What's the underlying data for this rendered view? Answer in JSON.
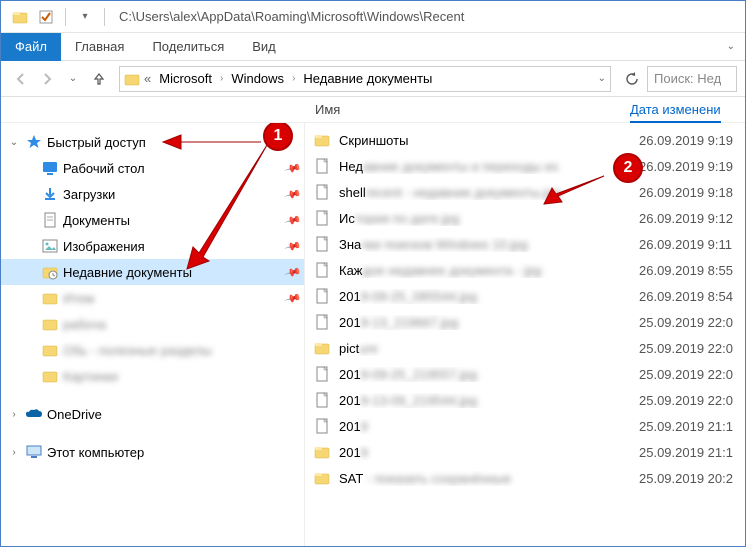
{
  "titlebar": {
    "address": "C:\\Users\\alex\\AppData\\Roaming\\Microsoft\\Windows\\Recent"
  },
  "ribbon": {
    "file": "Файл",
    "home": "Главная",
    "share": "Поделиться",
    "view": "Вид"
  },
  "nav": {
    "breadcrumb": [
      "Microsoft",
      "Windows",
      "Недавние документы"
    ],
    "search_placeholder": "Поиск: Нед"
  },
  "columns": {
    "name": "Имя",
    "date": "Дата изменени"
  },
  "tree": {
    "quick": "Быстрый доступ",
    "desktop": "Рабочий стол",
    "downloads": "Загрузки",
    "documents": "Документы",
    "pictures": "Изображения",
    "recent": "Недавние документы",
    "blur1": "Итем",
    "blur2": "рабоча",
    "blur3": "Обь - полезные разделы",
    "blur4": "Картинки",
    "onedrive": "OneDrive",
    "thispc": "Этот компьютер"
  },
  "files": [
    {
      "name": "Скриншоты",
      "type": "folder",
      "date": "26.09.2019 9:19"
    },
    {
      "name_prefix": "Нед",
      "name_blur": "авние документы и переходы из",
      "type": "file",
      "date": "26.09.2019 9:19"
    },
    {
      "name_prefix": "shell",
      "name_blur": "recent - недавние документы.jpg",
      "type": "file",
      "date": "26.09.2019 9:18"
    },
    {
      "name_prefix": "Ис",
      "name_blur": "тория по дате.jpg",
      "type": "file",
      "date": "26.09.2019 9:12"
    },
    {
      "name_prefix": "Зна",
      "name_blur": "чки поисков Windows 10.jpg",
      "type": "file",
      "date": "26.09.2019 9:11"
    },
    {
      "name_prefix": "Каж",
      "name_blur": "дое недавнее документа - jpg",
      "type": "file",
      "date": "26.09.2019 8:55"
    },
    {
      "name_prefix": "201",
      "name_blur": "9-09-25_085544.jpg",
      "type": "file",
      "date": "26.09.2019 8:54"
    },
    {
      "name_prefix": "201",
      "name_blur": "9-13_219667.jpg",
      "type": "file",
      "date": "25.09.2019 22:0"
    },
    {
      "name_prefix": "pict",
      "name_blur": "ure",
      "type": "folder",
      "date": "25.09.2019 22:0"
    },
    {
      "name_prefix": "201",
      "name_blur": "9-09-25_219557.jpg",
      "type": "file",
      "date": "25.09.2019 22:0"
    },
    {
      "name_prefix": "201",
      "name_blur": "9-13-09_219544.jpg",
      "type": "file",
      "date": "25.09.2019 22:0"
    },
    {
      "name_prefix": "201",
      "name_blur": "9",
      "type": "file",
      "date": "25.09.2019 21:1"
    },
    {
      "name_prefix": "201",
      "name_blur": "9",
      "type": "folder",
      "date": "25.09.2019 21:1"
    },
    {
      "name_prefix": "SAT",
      "name_blur": " - показать сохранённые",
      "type": "folder",
      "date": "25.09.2019 20:2"
    }
  ],
  "annotations": {
    "b1": "1",
    "b2": "2"
  }
}
